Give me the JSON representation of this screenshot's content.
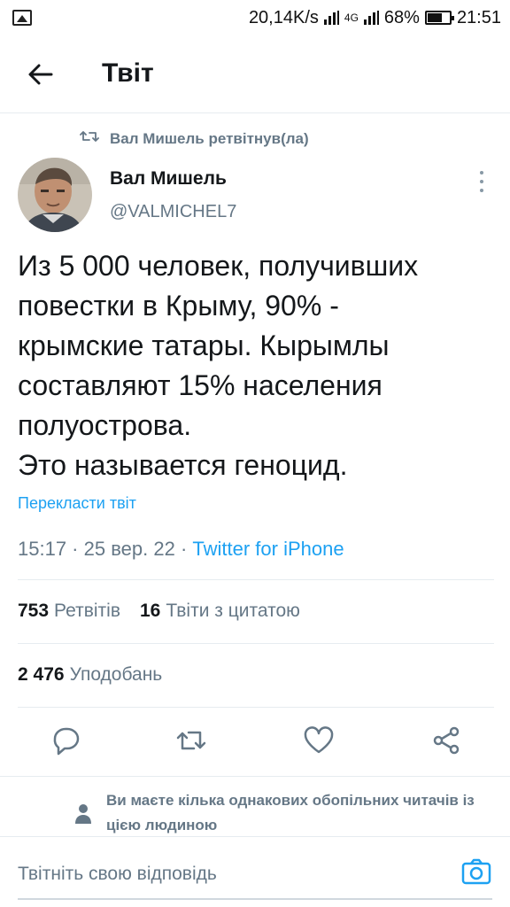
{
  "status_bar": {
    "net_speed": "20,14K/s",
    "network_label": "4G",
    "battery": "68%",
    "battery_level": 0.68,
    "time": "21:51"
  },
  "header": {
    "title": "Твіт"
  },
  "retweet": {
    "label": "Вал Мишель ретвітнув(ла)"
  },
  "author": {
    "name": "Вал Мишель",
    "handle": "@VALMICHEL7"
  },
  "tweet": {
    "text": "Из 5 000 человек, получивших\nповестки в Крыму, 90% -\nкрымские татары. Кырымлы\nсоставляют 15% населения\nполуострова.\nЭто называется геноцид.",
    "translate_label": "Перекласти твіт",
    "time": "15:17",
    "date": "25 вер. 22",
    "source": "Twitter for iPhone",
    "separator": " · "
  },
  "stats": {
    "retweets_count": "753",
    "retweets_label": "Ретвітів",
    "quotes_count": "16",
    "quotes_label": "Твіти з цитатою",
    "likes_count": "2 476",
    "likes_label": "Уподобань"
  },
  "actions": {
    "icons": [
      "reply-icon",
      "retweet-icon",
      "like-icon",
      "share-icon"
    ]
  },
  "followers_note": "Ви маєте кілька однакових обопільних читачів із цією людиною",
  "reply": {
    "placeholder": "Твітніть свою відповідь"
  },
  "colors": {
    "accent": "#1da1f2",
    "muted": "#657786",
    "text": "#14171a"
  }
}
